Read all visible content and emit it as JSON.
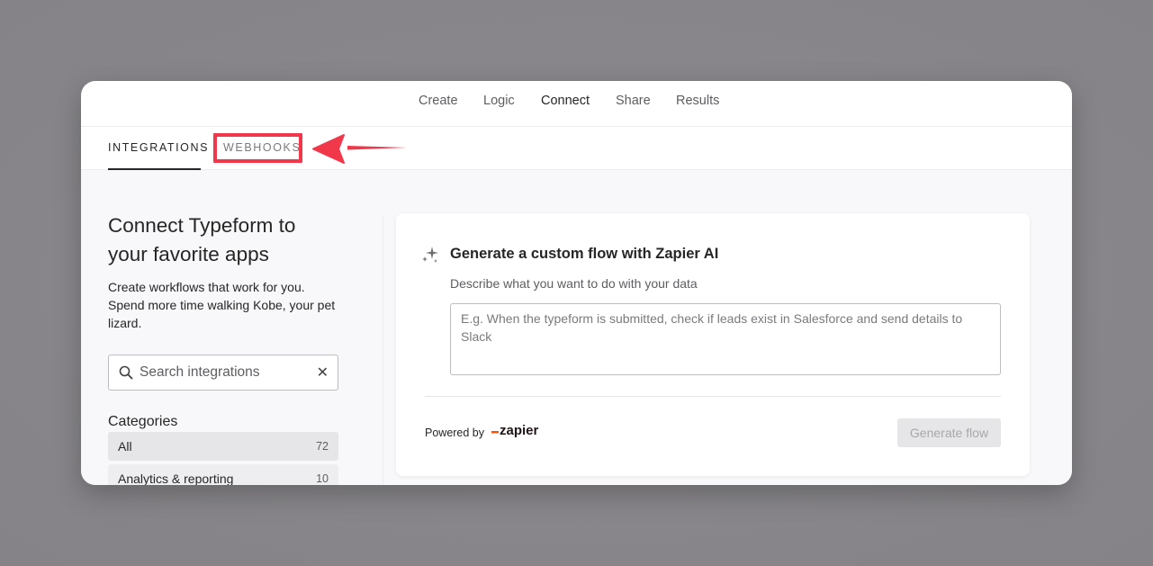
{
  "nav": {
    "items": [
      "Create",
      "Logic",
      "Connect",
      "Share",
      "Results"
    ],
    "active": "Connect"
  },
  "tabs": {
    "integrations": "INTEGRATIONS",
    "webhooks": "WEBHOOKS"
  },
  "sidebar": {
    "title_line1": "Connect Typeform to",
    "title_line2": "your favorite apps",
    "description": "Create workflows that work for you. Spend more time walking Kobe, your pet lizard.",
    "search_placeholder": "Search integrations",
    "categories_heading": "Categories",
    "categories": [
      {
        "label": "All",
        "count": "72"
      },
      {
        "label": "Analytics & reporting",
        "count": "10"
      }
    ]
  },
  "card": {
    "title": "Generate a custom flow with Zapier AI",
    "subtitle": "Describe what you want to do with your data",
    "textarea_placeholder": "E.g. When the typeform is submitted, check if leads exist in Salesforce and send details to Slack",
    "powered_by": "Powered by",
    "logo_text": "zapier",
    "generate_label": "Generate flow"
  },
  "icons": {
    "search": "search-icon",
    "clear": "close-icon",
    "sparkle": "sparkle-icon",
    "arrow": "annotation-arrow-icon"
  },
  "colors": {
    "annotation_red": "#f0384a",
    "zapier_orange": "#ff4f00",
    "backdrop": "#8b898d"
  }
}
